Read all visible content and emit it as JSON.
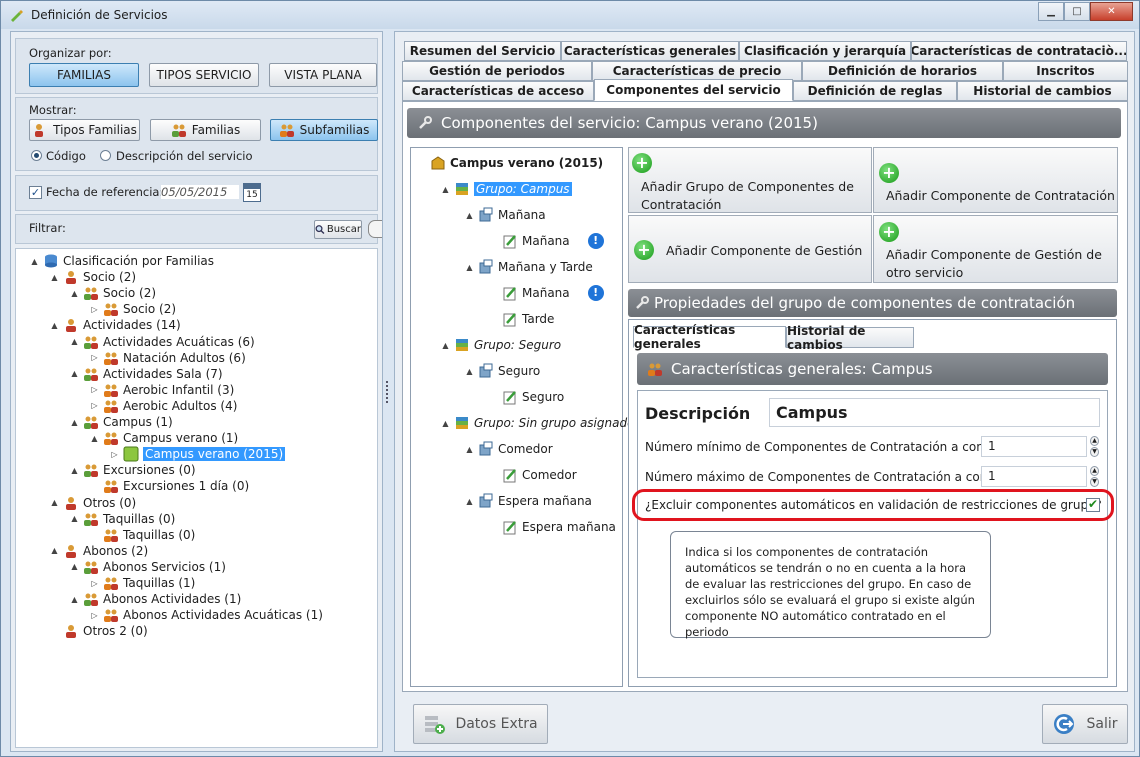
{
  "window": {
    "title": "Definición de Servicios"
  },
  "left": {
    "organize_label": "Organizar por:",
    "organize_buttons": [
      "FAMILIAS",
      "TIPOS SERVICIO",
      "VISTA PLANA"
    ],
    "show_label": "Mostrar:",
    "show_buttons": [
      "Tipos Familias",
      "Familias",
      "Subfamilias"
    ],
    "radio_options": [
      "Código",
      "Descripción del servicio"
    ],
    "ref_date_label": "Fecha de referencia:",
    "ref_date_value": "05/05/2015",
    "calendar_day": "15",
    "filter_label": "Filtrar:",
    "search_button": "Buscar",
    "tree": [
      {
        "label": "Clasificación por Familias"
      },
      {
        "label": "Socio (2)"
      },
      {
        "label": "Socio (2)"
      },
      {
        "label": "Socio (2)"
      },
      {
        "label": "Actividades (14)"
      },
      {
        "label": "Actividades Acuáticas (6)"
      },
      {
        "label": "Natación Adultos (6)"
      },
      {
        "label": "Actividades Sala (7)"
      },
      {
        "label": "Aerobic Infantil (3)"
      },
      {
        "label": "Aerobic Adultos (4)"
      },
      {
        "label": "Campus (1)"
      },
      {
        "label": "Campus verano (1)"
      },
      {
        "label": "Campus verano (2015)"
      },
      {
        "label": "Excursiones (0)"
      },
      {
        "label": "Excursiones 1 día (0)"
      },
      {
        "label": "Otros (0)"
      },
      {
        "label": "Taquillas (0)"
      },
      {
        "label": "Taquillas (0)"
      },
      {
        "label": "Abonos (2)"
      },
      {
        "label": "Abonos Servicios (1)"
      },
      {
        "label": "Taquillas (1)"
      },
      {
        "label": "Abonos Actividades (1)"
      },
      {
        "label": "Abonos Actividades Acuáticas (1)"
      },
      {
        "label": "Otros 2 (0)"
      }
    ]
  },
  "tabs": {
    "row1": [
      "Resumen del Servicio",
      "Características generales",
      "Clasificación y jerarquía",
      "Características de contrataciò..."
    ],
    "row2": [
      "Gestión de periodos",
      "Características de precio",
      "Definición de horarios",
      "Inscritos"
    ],
    "row3": [
      "Características de acceso",
      "Componentes del servicio",
      "Definición de reglas",
      "Historial de cambios"
    ]
  },
  "main": {
    "header": "Componentes del servicio: Campus verano (2015)",
    "ctree": [
      {
        "label": "Campus verano (2015)"
      },
      {
        "label": "Grupo: Campus"
      },
      {
        "label": "Mañana"
      },
      {
        "label": "Mañana"
      },
      {
        "label": "Mañana y Tarde"
      },
      {
        "label": "Mañana"
      },
      {
        "label": "Tarde"
      },
      {
        "label": "Grupo: Seguro"
      },
      {
        "label": "Seguro"
      },
      {
        "label": "Seguro"
      },
      {
        "label": "Grupo: Sin grupo asignado"
      },
      {
        "label": "Comedor"
      },
      {
        "label": "Comedor"
      },
      {
        "label": "Espera mañana"
      },
      {
        "label": "Espera mañana"
      }
    ],
    "add_buttons": [
      "Añadir Grupo de Componentes de Contratación",
      "Añadir Componente de Contratación",
      "Añadir Componente de Gestión",
      "Añadir Componente de Gestión de otro servicio"
    ],
    "props_header": "Propiedades del grupo de componentes de contratación",
    "sub_tabs": [
      "Características generales",
      "Historial de cambios"
    ],
    "inner_header": "Características generales: Campus",
    "desc_label": "Descripción",
    "desc_value": "Campus",
    "min_label": "Número mínimo de Componentes de Contratación a contratar",
    "min_value": "1",
    "max_label": "Número máximo de Componentes de Contratación a contratar",
    "max_value": "1",
    "exclude_label": "¿Excluir componentes automáticos en validación de restricciones de grupo?",
    "tooltip": "Indica si los componentes de contratación automáticos se tendrán o no en cuenta a la hora de evaluar las restricciones del grupo. En caso de excluirlos sólo se evaluará el grupo si existe algún componente NO automático contratado en el periodo"
  },
  "bottom": {
    "extra_button": "Datos Extra",
    "exit_button": "Salir"
  },
  "colors": {
    "selection": "#3399ff",
    "red_highlight": "#e0141e",
    "header_gray": "#7a7f85"
  }
}
